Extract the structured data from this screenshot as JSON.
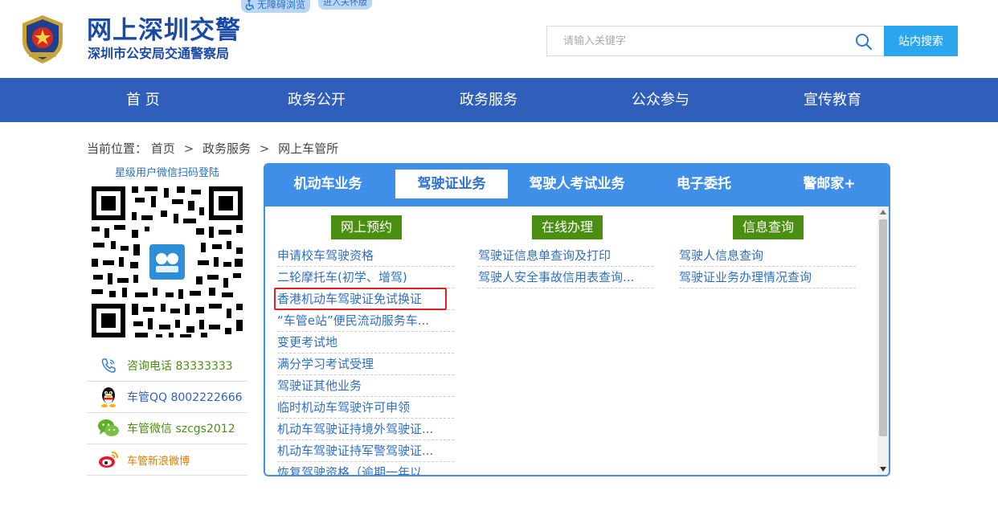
{
  "header": {
    "title": "网上深圳交警",
    "subtitle": "深圳市公安局交通警察局",
    "accessibility_label": "无障碍浏览",
    "care_label": "进入关怀版",
    "search_placeholder": "请输入关键字",
    "search_button": "站内搜索"
  },
  "nav": {
    "items": [
      "首 页",
      "政务公开",
      "政务服务",
      "公众参与",
      "宣传教育"
    ]
  },
  "breadcrumb": {
    "prefix": "当前位置：",
    "items": [
      "首页",
      "政务服务",
      "网上车管所"
    ],
    "separator": ">"
  },
  "sidebar": {
    "qr_title": "星级用户微信扫码登陆",
    "contacts": [
      {
        "label": "咨询电话 83333333",
        "icon": "phone-icon",
        "color": "#4b8f12"
      },
      {
        "label": "车管QQ 8002222666",
        "icon": "qq-penguin-icon",
        "color": "#2f5fbb"
      },
      {
        "label": "车管微信 szcgs2012",
        "icon": "wechat-icon",
        "color": "#4b8f12"
      },
      {
        "label": "车管新浪微博",
        "icon": "weibo-icon",
        "color": "#e07b00"
      }
    ]
  },
  "panel": {
    "tabs": [
      "机动车业务",
      "驾驶证业务",
      "驾驶人考试业务",
      "电子委托",
      "警邮家+"
    ],
    "active_tab": "驾驶证业务",
    "columns": [
      {
        "title": "网上预约",
        "links": [
          "申请校车驾驶资格",
          "二轮摩托车(初学、增驾)",
          "香港机动车驾驶证免试换证",
          "“车管e站”便民流动服务车...",
          "变更考试地",
          "满分学习考试受理",
          "驾驶证其他业务",
          "临时机动车驾驶许可申领",
          "机动车驾驶证持境外驾驶证...",
          "机动车驾驶证持军警驾驶证...",
          "恢复驾驶资格（逾期一年以"
        ]
      },
      {
        "title": "在线办理",
        "links": [
          "驾驶证信息单查询及打印",
          "驾驶人安全事故信用表查询..."
        ]
      },
      {
        "title": "信息查询",
        "links": [
          "驾驶人信息查询",
          "驾驶证业务办理情况查询"
        ]
      }
    ],
    "highlighted_link": "香港机动车驾驶证免试换证"
  },
  "colors": {
    "brand_blue": "#1a4aa6",
    "nav_blue": "#2f5fbb",
    "tab_blue": "#3f8ee8",
    "search_blue": "#2aa6ee",
    "column_green": "#4b8f12",
    "highlight_red": "#e02020"
  }
}
